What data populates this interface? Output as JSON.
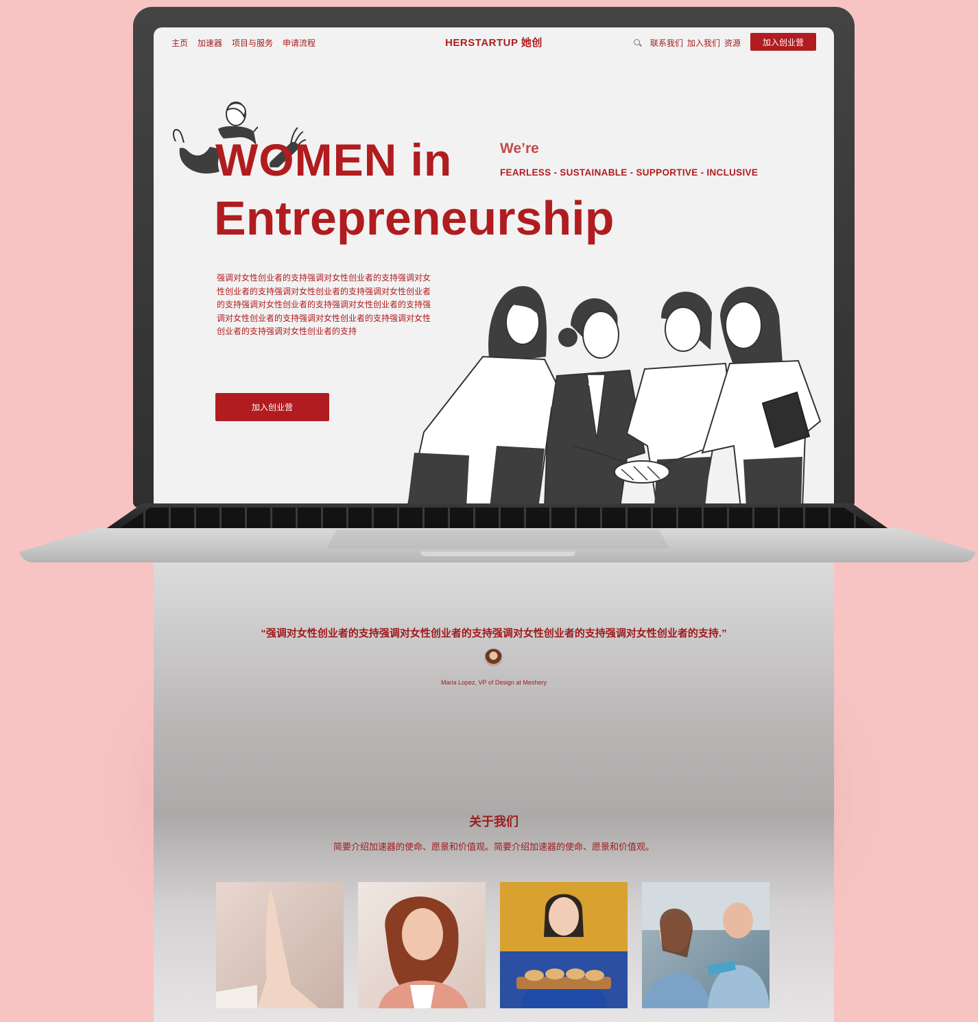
{
  "nav": {
    "left_links": [
      "主页",
      "加速器",
      "项目与服务",
      "申请流程"
    ],
    "brand": "HERSTARTUP 她创",
    "right_links": [
      "联系我们",
      "加入我们",
      "资源"
    ],
    "cta": "加入创业营"
  },
  "hero": {
    "title_line1": "WOMEN in",
    "title_line2": "Entrepreneurship",
    "were": "We’re",
    "values": "FEARLESS - SUSTAINABLE - SUPPORTIVE - INCLUSIVE",
    "body": "强调对女性创业者的支持强调对女性创业者的支持强调对女性创业者的支持强调对女性创业者的支持强调对女性创业者的支持强调对女性创业者的支持强调对女性创业者的支持强调对女性创业者的支持强调对女性创业者的支持强调对女性创业者的支持强调对女性创业者的支持",
    "cta": "加入创业营"
  },
  "testimonial": {
    "quote": "“强调对女性创业者的支持强调对女性创业者的支持强调对女性创业者的支持强调对女性创业者的支持.”",
    "author": "Maria Lopez, VP of Design at Meshery"
  },
  "about": {
    "title": "关于我们",
    "description": "简要介绍加速器的使命、愿景和价值观。简要介绍加速器的使命、愿景和价值观。"
  },
  "colors": {
    "brand_red": "#b01c1f",
    "background_pink": "#f7c4c3",
    "illustration_gray": "#3e3e3e"
  }
}
